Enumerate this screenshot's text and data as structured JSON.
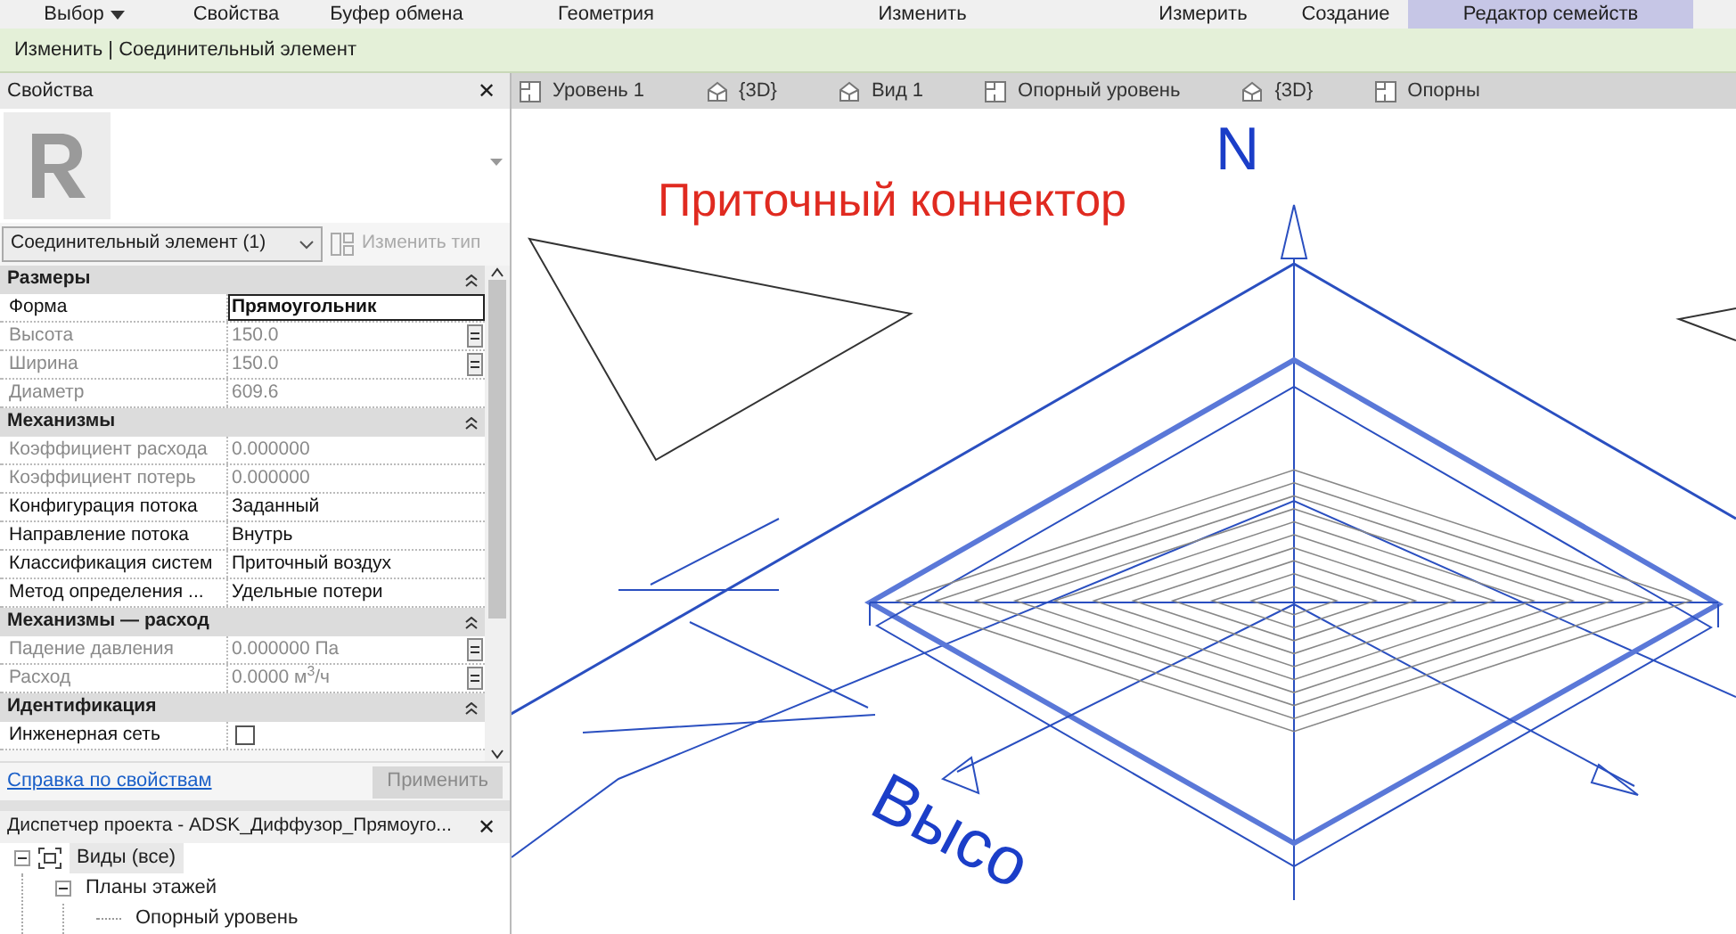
{
  "ribbon": {
    "tabs": [
      {
        "label": "Выбор",
        "dropdown": true,
        "selected": false
      },
      {
        "label": "Свойства",
        "dropdown": false,
        "selected": false
      },
      {
        "label": "Буфер обмена",
        "dropdown": false,
        "selected": false
      },
      {
        "label": "Геометрия",
        "dropdown": false,
        "selected": false
      },
      {
        "label": "Изменить",
        "dropdown": false,
        "selected": false
      },
      {
        "label": "Измерить",
        "dropdown": false,
        "selected": false
      },
      {
        "label": "Создание",
        "dropdown": false,
        "selected": false
      },
      {
        "label": "Редактор семейств",
        "dropdown": false,
        "selected": true
      }
    ]
  },
  "context_bar": {
    "title": "Изменить | Соединительный элемент"
  },
  "properties": {
    "title": "Свойства",
    "close": "✕",
    "type_selector": "Соединительный элемент (1)",
    "edit_type": "Изменить тип",
    "groups": [
      {
        "title": "Размеры",
        "rows": [
          {
            "name": "Форма",
            "value": "Прямоугольник",
            "disabled": false,
            "editing": true,
            "button": false
          },
          {
            "name": "Высота",
            "value": "150.0",
            "disabled": true,
            "editing": false,
            "button": true
          },
          {
            "name": "Ширина",
            "value": "150.0",
            "disabled": true,
            "editing": false,
            "button": true
          },
          {
            "name": "Диаметр",
            "value": "609.6",
            "disabled": true,
            "editing": false,
            "button": false
          }
        ]
      },
      {
        "title": "Механизмы",
        "rows": [
          {
            "name": "Коэффициент расхода",
            "value": "0.000000",
            "disabled": true,
            "editing": false,
            "button": false
          },
          {
            "name": "Коэффициент потерь",
            "value": "0.000000",
            "disabled": true,
            "editing": false,
            "button": false
          },
          {
            "name": "Конфигурация потока",
            "value": "Заданный",
            "disabled": false,
            "editing": false,
            "button": false
          },
          {
            "name": "Направление потока",
            "value": "Внутрь",
            "disabled": false,
            "editing": false,
            "button": false
          },
          {
            "name": "Классификация систем",
            "value": "Приточный воздух",
            "disabled": false,
            "editing": false,
            "button": false
          },
          {
            "name": "Метод определения ...",
            "value": "Удельные потери",
            "disabled": false,
            "editing": false,
            "button": false
          }
        ]
      },
      {
        "title": "Механизмы — расход",
        "rows": [
          {
            "name": "Падение давления",
            "value": "0.000000 Па",
            "disabled": true,
            "editing": false,
            "button": true
          },
          {
            "name": "Расход",
            "value": "0.0000 м$^{3}$/ч",
            "disabled": true,
            "editing": false,
            "button": true
          }
        ]
      },
      {
        "title": "Идентификация",
        "rows": [
          {
            "name": "Инженерная сеть",
            "kind": "checkbox",
            "checked": false,
            "disabled": false,
            "button": false
          }
        ]
      }
    ],
    "help_link": "Справка по свойствам",
    "apply": "Применить"
  },
  "project_browser": {
    "title": "Диспетчер проекта - ADSK_Диффузор_Прямоуго...",
    "close": "✕",
    "tree": [
      {
        "label": "Виды (все)",
        "expanded": true,
        "selected": true,
        "children": [
          {
            "label": "Планы этажей",
            "expanded": true,
            "selected": false,
            "children": [
              {
                "label": "Опорный уровень",
                "selected": false
              }
            ]
          }
        ]
      }
    ]
  },
  "view_tabs": [
    {
      "label": "Уровень 1",
      "kind": "plan"
    },
    {
      "label": "{3D}",
      "kind": "perspective"
    },
    {
      "label": "Вид 1",
      "kind": "perspective"
    },
    {
      "label": "Опорный уровень",
      "kind": "plan"
    },
    {
      "label": "{3D}",
      "kind": "perspective"
    },
    {
      "label": "Опорны",
      "kind": "plan"
    }
  ],
  "canvas": {
    "annotation": "Приточный коннектор",
    "north": "N",
    "dimension_label": "Высо"
  }
}
